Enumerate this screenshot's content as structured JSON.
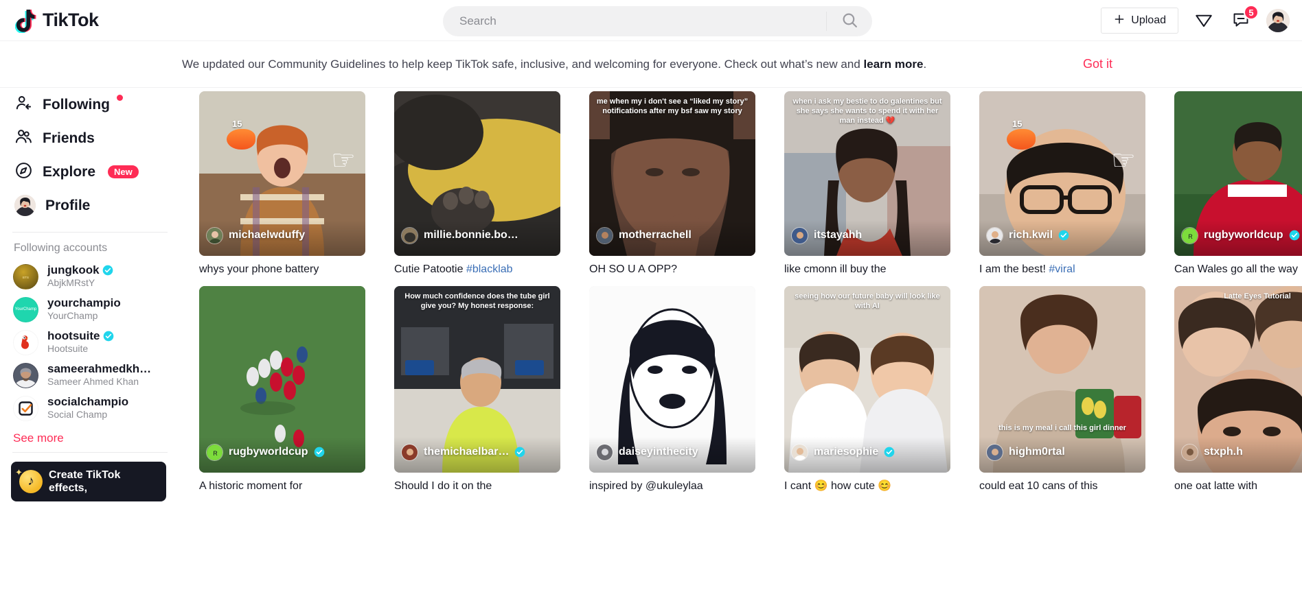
{
  "header": {
    "logo_text": "TikTok",
    "search_placeholder": "Search",
    "search_value": "",
    "upload_label": "Upload",
    "messages_badge": "5"
  },
  "banner": {
    "text_part1": "We updated our Community Guidelines to help keep TikTok safe, inclusive, and welcoming for everyone. Check out what’s new and ",
    "text_link": "learn more",
    "text_end": ".",
    "got_it_label": "Got it"
  },
  "sidebar": {
    "nav": [
      {
        "label": "Following",
        "dot": true
      },
      {
        "label": "Friends",
        "dot": false
      },
      {
        "label": "Explore",
        "badge": "New"
      },
      {
        "label": "Profile"
      }
    ],
    "accounts_title": "Following accounts",
    "accounts": [
      {
        "name": "jungkook",
        "sub": "AbjkMRstY",
        "verified": true,
        "color": "#6b5a20"
      },
      {
        "name": "yourchampio",
        "sub": "YourChamp",
        "verified": false,
        "color": "#1fd6ae",
        "mono": "YourChamp"
      },
      {
        "name": "hootsuite",
        "sub": "Hootsuite",
        "verified": true,
        "color": "#ffffff"
      },
      {
        "name": "sameerahmedkh…",
        "sub": "Sameer Ahmed Khan",
        "verified": false,
        "color": "#4a4f5e"
      },
      {
        "name": "socialchampio",
        "sub": "Social Champ",
        "verified": false,
        "color": "#ffffff"
      }
    ],
    "see_more_label": "See more",
    "effects_label": "Create TikTok effects,"
  },
  "feed": {
    "videos": [
      {
        "user": "michaelwduffy",
        "verified": false,
        "caption": "whys your phone battery",
        "tag": ""
      },
      {
        "user": "millie.bonnie.bo…",
        "verified": false,
        "caption": "Cutie Patootie ",
        "tag": "#blacklab"
      },
      {
        "user": "motherrachell",
        "verified": false,
        "caption": "OH SO U A OPP?",
        "tag": ""
      },
      {
        "user": "itstayahh",
        "verified": false,
        "caption": "like cmonn ill buy the",
        "tag": ""
      },
      {
        "user": "rich.kwil",
        "verified": true,
        "caption": "I am the best! ",
        "tag": "#viral"
      },
      {
        "user": "rugbyworldcup",
        "verified": true,
        "caption": "Can Wales go all the way",
        "tag": ""
      },
      {
        "user": "rugbyworldcup",
        "verified": true,
        "caption": "A historic moment for",
        "tag": ""
      },
      {
        "user": "themichaelbar…",
        "verified": true,
        "caption": "Should I do it on the",
        "tag": ""
      },
      {
        "user": "daiseyinthecity",
        "verified": false,
        "caption": "inspired by @ukuleylaa",
        "tag": ""
      },
      {
        "user": "mariesophie",
        "verified": true,
        "caption": "I cant 😊 how cute 😊",
        "tag": ""
      },
      {
        "user": "highm0rtal",
        "verified": false,
        "caption": "could eat 10 cans of this",
        "tag": ""
      },
      {
        "user": "stxph.h",
        "verified": false,
        "caption": "one oat latte with",
        "tag": ""
      }
    ],
    "overlays": {
      "v4_meme": "when i ask my bestie to do galentines but she says she wants to spend it with her man instead 💔",
      "v3_meme": "me when my i don't see a “liked my story” notifications after my bsf saw my story",
      "v2_num": "15",
      "v5_num": "15",
      "v8_meme": "How much confidence does the tube girl give you?  My honest response:",
      "v11_meme": "this is my meal i call this girl dinner",
      "v12_meme": "Latte Eyes Tutorial",
      "v10_meme": "seeing how our future baby will look like with AI"
    }
  }
}
